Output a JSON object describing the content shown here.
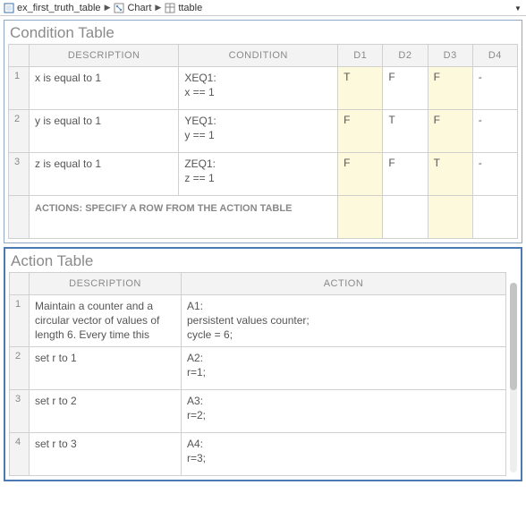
{
  "breadcrumbs": [
    {
      "icon": "model",
      "label": "ex_first_truth_table"
    },
    {
      "icon": "chart",
      "label": "Chart"
    },
    {
      "icon": "ttable",
      "label": "ttable"
    }
  ],
  "condition": {
    "title": "Condition Table",
    "headers": {
      "desc": "DESCRIPTION",
      "cond": "CONDITION",
      "d": [
        "D1",
        "D2",
        "D3",
        "D4"
      ]
    },
    "rows": [
      {
        "n": "1",
        "desc": "x is equal to 1",
        "cond": "XEQ1:\nx == 1",
        "d": [
          "T",
          "F",
          "F",
          "-"
        ],
        "hl": [
          true,
          false,
          true,
          false
        ]
      },
      {
        "n": "2",
        "desc": "y is equal to 1",
        "cond": "YEQ1:\ny == 1",
        "d": [
          "F",
          "T",
          "F",
          "-"
        ],
        "hl": [
          true,
          false,
          true,
          false
        ]
      },
      {
        "n": "3",
        "desc": "z is equal to 1",
        "cond": "ZEQ1:\nz == 1",
        "d": [
          "F",
          "F",
          "T",
          "-"
        ],
        "hl": [
          true,
          false,
          true,
          false
        ]
      }
    ],
    "actions_label": "ACTIONS: SPECIFY A ROW FROM THE ACTION TABLE",
    "actions_d": [
      "",
      "",
      "",
      ""
    ],
    "actions_hl": [
      true,
      false,
      true,
      false
    ]
  },
  "action": {
    "title": "Action Table",
    "headers": {
      "desc": "DESCRIPTION",
      "act": "ACTION"
    },
    "rows": [
      {
        "n": "1",
        "desc": "Maintain a counter and a circular vector of values of length 6. Every time this",
        "act": "A1:\npersistent values counter;\ncycle = 6;"
      },
      {
        "n": "2",
        "desc": "set r to 1",
        "act": "A2:\nr=1;"
      },
      {
        "n": "3",
        "desc": "set r to 2",
        "act": "A3:\nr=2;"
      },
      {
        "n": "4",
        "desc": "set r to 3",
        "act": "A4:\nr=3;"
      }
    ]
  },
  "chart_data": {
    "type": "table",
    "title": "Truth Table",
    "conditions": [
      {
        "label": "XEQ1",
        "expr": "x == 1",
        "description": "x is equal to 1"
      },
      {
        "label": "YEQ1",
        "expr": "y == 1",
        "description": "y is equal to 1"
      },
      {
        "label": "ZEQ1",
        "expr": "z == 1",
        "description": "z is equal to 1"
      }
    ],
    "decisions": {
      "D1": {
        "XEQ1": "T",
        "YEQ1": "F",
        "ZEQ1": "F"
      },
      "D2": {
        "XEQ1": "F",
        "YEQ1": "T",
        "ZEQ1": "F"
      },
      "D3": {
        "XEQ1": "F",
        "YEQ1": "F",
        "ZEQ1": "T"
      },
      "D4": {
        "XEQ1": "-",
        "YEQ1": "-",
        "ZEQ1": "-"
      }
    },
    "actions": [
      {
        "label": "A1",
        "description": "Maintain a counter and a circular vector of values of length 6. Every time this",
        "code": "persistent values counter;\ncycle = 6;"
      },
      {
        "label": "A2",
        "description": "set r to 1",
        "code": "r=1;"
      },
      {
        "label": "A3",
        "description": "set r to 2",
        "code": "r=2;"
      },
      {
        "label": "A4",
        "description": "set r to 3",
        "code": "r=3;"
      }
    ]
  }
}
